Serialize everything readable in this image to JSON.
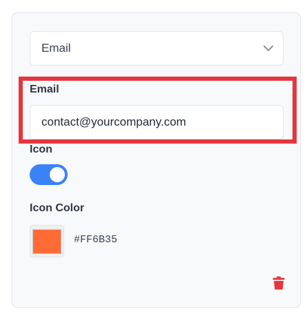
{
  "contact_type": {
    "selected": "Email",
    "icon": "chevron-down-icon"
  },
  "email": {
    "label": "Email",
    "value": "contact@yourcompany.com"
  },
  "icon_setting": {
    "label": "Icon",
    "enabled": true
  },
  "icon_color": {
    "label": "Icon Color",
    "value": "#FF6B35"
  },
  "actions": {
    "delete_icon": "trash-icon"
  },
  "colors": {
    "highlight": "#e5363d",
    "toggle_on": "#3a82f6",
    "delete": "#e5363d"
  }
}
